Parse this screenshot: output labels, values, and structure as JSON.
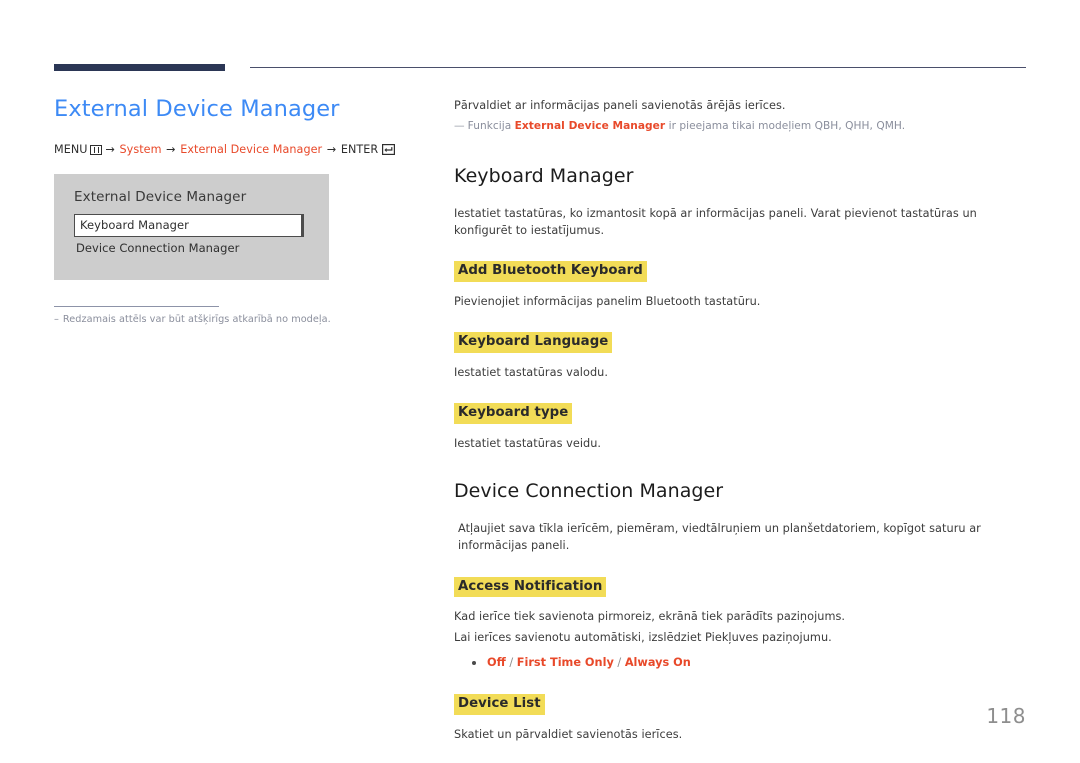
{
  "header": {
    "accent_color": "#2b3655",
    "rule_color": "#4a4f6b"
  },
  "left": {
    "page_title": "External Device Manager",
    "menu_path": {
      "menu_label": "MENU",
      "menu_icon": "menu-grid-icon",
      "arrow": "→",
      "step1": "System",
      "step2": "External Device Manager",
      "enter_label": "ENTER",
      "enter_icon": "enter-return-icon"
    },
    "osd": {
      "title": "External Device Manager",
      "items": [
        {
          "label": "Keyboard Manager",
          "selected": true
        },
        {
          "label": "Device Connection Manager",
          "selected": false
        }
      ]
    },
    "note": {
      "dash": "–",
      "text": "Redzamais attēls var būt atšķirīgs atkarībā no modeļa."
    }
  },
  "right": {
    "intro": "Pārvaldiet ar informācijas paneli savienotās ārējās ierīces.",
    "intro_note": {
      "dash": "—",
      "before": "Funkcija ",
      "accent": "External Device Manager",
      "after": " ir pieejama tikai modeļiem QBH, QHH, QMH."
    },
    "sections": [
      {
        "title": "Keyboard Manager",
        "body": "Iestatiet tastatūras, ko izmantosit kopā ar informācijas paneli. Varat pievienot tastatūras un konfigurēt to iestatījumus.",
        "subsections": [
          {
            "heading": "Add Bluetooth Keyboard",
            "body": "Pievienojiet informācijas panelim Bluetooth tastatūru."
          },
          {
            "heading": "Keyboard Language",
            "body": "Iestatiet tastatūras valodu."
          },
          {
            "heading": "Keyboard type",
            "body": "Iestatiet tastatūras veidu."
          }
        ]
      },
      {
        "title": "Device Connection Manager",
        "body": "Atļaujiet sava tīkla ierīcēm, piemēram, viedtālruņiem un planšetdatoriem, kopīgot saturu ar informācijas paneli.",
        "subsections": [
          {
            "heading": "Access Notification",
            "body": "Kad ierīce tiek savienota pirmoreiz, ekrānā tiek parādīts paziņojums.",
            "body2": "Lai ierīces savienotu automātiski, izslēdziet Piekļuves paziņojumu.",
            "options": [
              "Off",
              "First Time Only",
              "Always On"
            ],
            "option_separator": "/"
          },
          {
            "heading": "Device List",
            "body": "Skatiet un pārvaldiet savienotās ierīces."
          }
        ]
      }
    ]
  },
  "footer": {
    "page_number": "118"
  },
  "colors": {
    "title_blue": "#3d8af5",
    "accent_red": "#e8492a",
    "highlight_yellow": "#f2dc57",
    "osd_gray": "#cdcdcd",
    "note_gray": "#8a8e9c"
  }
}
